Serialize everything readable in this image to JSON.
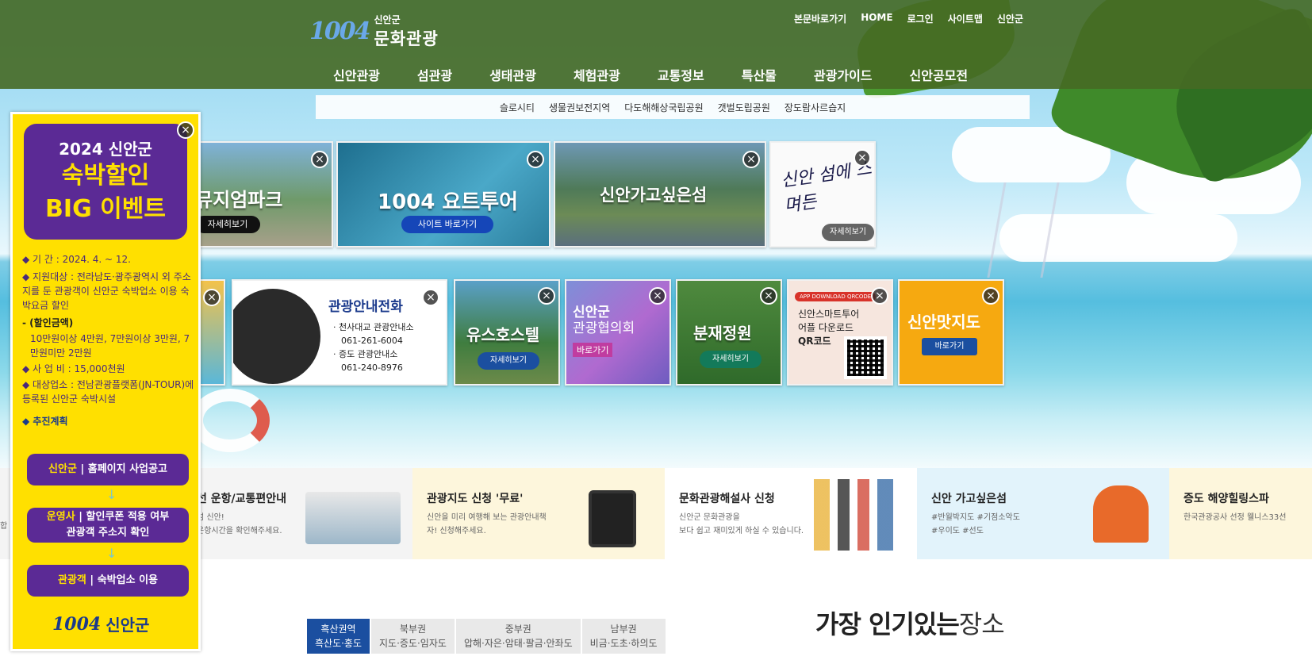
{
  "header": {
    "logo_mark": "1004",
    "logo_sub": "신안군",
    "logo_title": "문화관광",
    "util": [
      "본문바로가기",
      "HOME",
      "로그인",
      "사이트맵",
      "신안군"
    ],
    "gnb": [
      "신안관광",
      "섬관광",
      "생태관광",
      "체험관광",
      "교통정보",
      "특산물",
      "관광가이드",
      "신안공모전"
    ],
    "subnav": [
      "슬로시티",
      "생물권보전지역",
      "다도해해상국립공원",
      "갯벌도립공원",
      "장도람사르습지"
    ]
  },
  "popup": {
    "title1": "2024 신안군",
    "title2": "숙박할인",
    "title3": "BIG 이벤트",
    "period": "◆ 기 간 : 2024. 4. ~ 12.",
    "target": "◆ 지원대상 : 전라남도·광주광역시 외 주소지를 둔 관광객이 신안군 숙박업소 이용 숙박요금 할인",
    "discount_head": "- (할인금액)",
    "discount": "10만원이상 4만원, 7만원이상 3만원, 7만원미만 2만원",
    "budget": "◆ 사 업 비 : 15,000천원",
    "venue": "◆ 대상업소 : 전남관광플랫폼(JN-TOUR)에 등록된 신안군 숙박시설",
    "plan": "◆ 추진계획",
    "step1_a": "신안군",
    "step1_b": "홈페이지 사업공고",
    "step2_a": "운영사",
    "step2_b": "할인쿠폰 적용 여부",
    "step2_c": "관광객 주소지 확인",
    "step3_a": "관광객",
    "step3_b": "숙박업소 이용",
    "footer_mark": "1004",
    "footer_name": "신안군"
  },
  "cards_row1": [
    {
      "title": "뮤지엄파크",
      "button": "자세히보기"
    },
    {
      "title": "1004 요트투어",
      "button": "사이트 바로가기"
    },
    {
      "title": "신안가고싶은섬",
      "button": ""
    },
    {
      "title": "신안 섬에 스며든",
      "button": "자세히보기"
    }
  ],
  "cards_row2": {
    "phone_title": "관광안내전화",
    "phone_l1": "· 천사대교 관광안내소",
    "phone_n1": "061-261-6004",
    "phone_l2": "· 증도 관광안내소",
    "phone_n2": "061-240-8976",
    "hostel_title": "유스호스텔",
    "hostel_button": "자세히보기",
    "assoc_t1": "신안군",
    "assoc_t2": "관광협의회",
    "assoc_button": "바로가기",
    "garden_title": "분재정원",
    "garden_button": "자세히보기",
    "app_badge": "APP DOWNLOAD QRCODE",
    "app_l1": "신안스마트투어",
    "app_l2": "어플 다운로드",
    "app_l3": "QR코드",
    "food_title": "신안맛지도",
    "food_button": "바로가기"
  },
  "strip": [
    {
      "title": "선 운항/교통편안내",
      "sub1": "섬 신안!",
      "sub2": "운항시간을 확인해주세요."
    },
    {
      "title": "관광지도 신청 '무료'",
      "sub1": "신안을 미리 여행해 보는 관광안내책",
      "sub2": "자! 신청해주세요."
    },
    {
      "title": "문화관광해설사 신청",
      "sub1": "신안군 문화관광을",
      "sub2": "보다 쉽고 재미있게 하실 수 있습니다."
    },
    {
      "title": "신안 가고싶은섬",
      "sub1": "#반월박지도 #기점소악도",
      "sub2": "#우이도 #선도"
    },
    {
      "title": "증도 해양힐링스파",
      "sub1": "한국관광공사 선정 웰니스33선",
      "sub2": ""
    }
  ],
  "strip_edge": "합",
  "regions": [
    {
      "name": "흑산권역",
      "places": "흑산도·홍도"
    },
    {
      "name": "북부권",
      "places": "지도·증도·임자도"
    },
    {
      "name": "중부권",
      "places": "압해·자은·암태·팔금·안좌도"
    },
    {
      "name": "남부권",
      "places": "비금·도초·하의도"
    }
  ],
  "popular_bold": "가장 인기있는",
  "popular_rest": "장소",
  "close_glyph": "×"
}
